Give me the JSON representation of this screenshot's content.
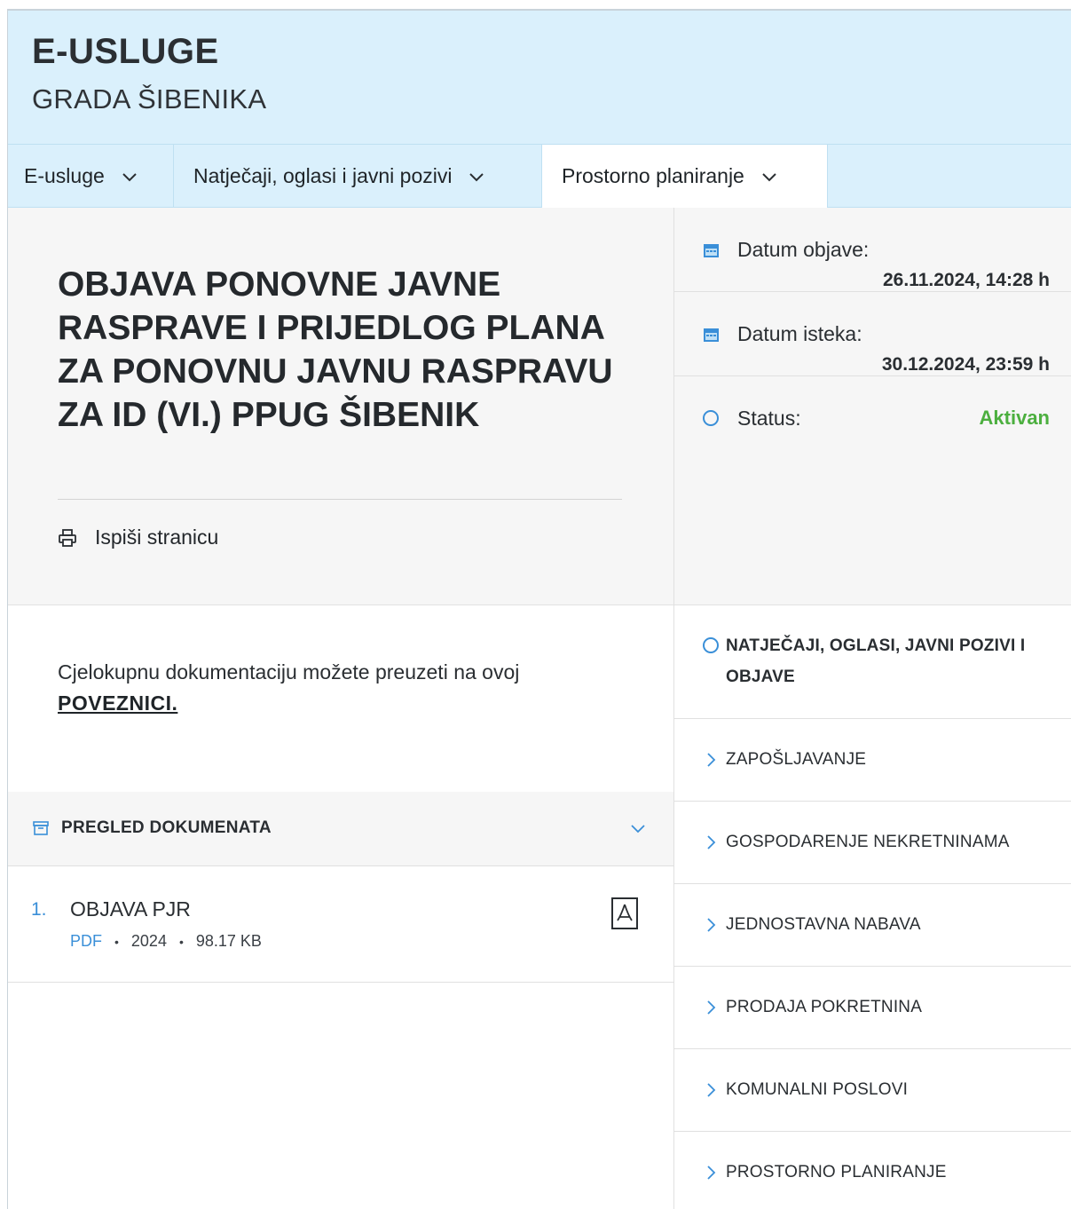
{
  "header": {
    "title": "E-USLUGE",
    "subtitle": "GRADA ŠIBENIKA"
  },
  "nav": {
    "items": [
      {
        "label": "E-usluge"
      },
      {
        "label": "Natječaji, oglasi i javni pozivi"
      },
      {
        "label": "Prostorno planiranje"
      }
    ]
  },
  "article": {
    "title": "OBJAVA PONOVNE JAVNE RASPRAVE I PRIJEDLOG PLANA ZA PONOVNU JAVNU RASPRAVU ZA ID (VI.) PPUG ŠIBENIK",
    "print_label": "Ispiši stranicu",
    "intro_text": "Cjelokupnu dokumentaciju možete preuzeti na ovoj",
    "intro_link": "POVEZNICI."
  },
  "info": {
    "published_label": "Datum objave:",
    "published_value": "26.11.2024, 14:28 h",
    "expires_label": "Datum isteka:",
    "expires_value": "30.12.2024, 23:59 h",
    "status_label": "Status:",
    "status_value": "Aktivan",
    "status_color": "#4caf3f",
    "accent_color": "#3a8fd8"
  },
  "documents": {
    "header_label": "PREGLED DOKUMENATA",
    "items": [
      {
        "number": "1.",
        "name": "OBJAVA PJR",
        "format": "PDF",
        "year": "2024",
        "size": "98.17 KB",
        "icon": "pdf-file-icon"
      }
    ]
  },
  "categories": {
    "header": "NATJEČAJI, OGLASI, JAVNI POZIVI I OBJAVE",
    "items": [
      "ZAPOŠLJAVANJE",
      "GOSPODARENJE NEKRETNINAMA",
      "JEDNOSTAVNA NABAVA",
      "PRODAJA POKRETNINA",
      "KOMUNALNI POSLOVI",
      "PROSTORNO PLANIRANJE"
    ]
  }
}
